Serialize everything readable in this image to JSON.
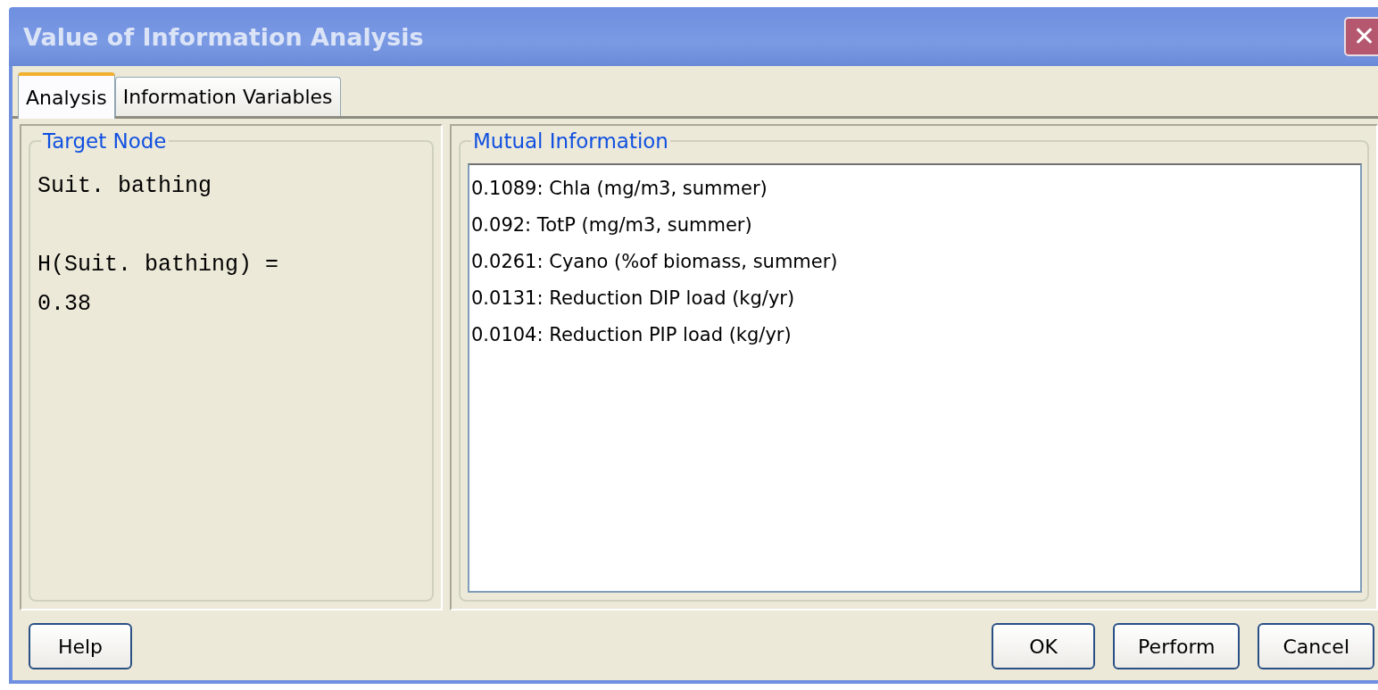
{
  "window": {
    "title": "Value of Information Analysis",
    "close": "✕"
  },
  "tabs": [
    {
      "label": "Analysis",
      "selected": true
    },
    {
      "label": "Information Variables",
      "selected": false
    }
  ],
  "target_node": {
    "title": "Target Node",
    "node": "Suit. bathing",
    "entropy_lines": [
      "H(Suit. bathing) =",
      "0.38"
    ]
  },
  "mutual_information": {
    "title": "Mutual Information",
    "items": [
      "0.1089: Chla (mg/m3, summer)",
      "0.092: TotP (mg/m3, summer)",
      "0.0261: Cyano (%of biomass, summer)",
      "0.0131: Reduction DIP load (kg/yr)",
      "0.0104: Reduction PIP load (kg/yr)"
    ]
  },
  "buttons_left": [
    "Help"
  ],
  "buttons_right": [
    "OK",
    "Perform",
    "Cancel"
  ]
}
